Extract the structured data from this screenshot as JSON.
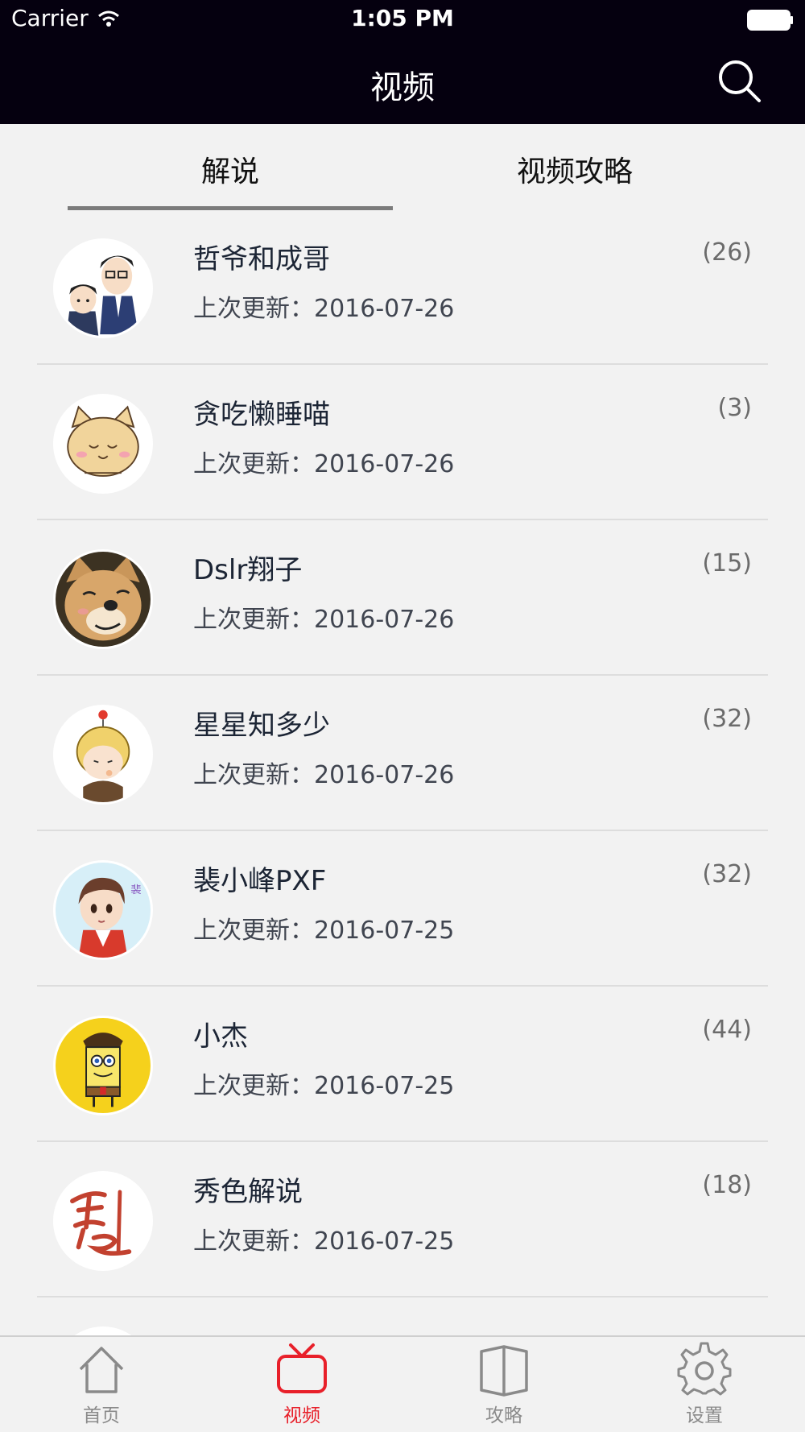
{
  "status_bar": {
    "carrier": "Carrier",
    "time": "1:05 PM"
  },
  "nav": {
    "title": "视频"
  },
  "tabs": [
    {
      "label": "解说",
      "selected": true
    },
    {
      "label": "视频攻略",
      "selected": false
    }
  ],
  "list": [
    {
      "name": "哲爷和成哥",
      "updated": "上次更新：2016-07-26",
      "count": "(26)",
      "avatar": "cartoon-two-men"
    },
    {
      "name": "贪吃懒睡喵",
      "updated": "上次更新：2016-07-26",
      "count": "(3)",
      "avatar": "cartoon-sleepy-cat"
    },
    {
      "name": "Dslr翔子",
      "updated": "上次更新：2016-07-26",
      "count": "(15)",
      "avatar": "shiba-dog"
    },
    {
      "name": "星星知多少",
      "updated": "上次更新：2016-07-26",
      "count": "(32)",
      "avatar": "cartoon-blonde-kid"
    },
    {
      "name": "裴小峰PXF",
      "updated": "上次更新：2016-07-25",
      "count": "(32)",
      "avatar": "cartoon-boy"
    },
    {
      "name": "小杰",
      "updated": "上次更新：2016-07-25",
      "count": "(44)",
      "avatar": "sponge-character"
    },
    {
      "name": "秀色解说",
      "updated": "上次更新：2016-07-25",
      "count": "(18)",
      "avatar": "calligraphy-logo"
    }
  ],
  "tabbar": [
    {
      "label": "首页",
      "icon": "home-icon",
      "active": false
    },
    {
      "label": "视频",
      "icon": "tv-icon",
      "active": true
    },
    {
      "label": "攻略",
      "icon": "book-icon",
      "active": false
    },
    {
      "label": "设置",
      "icon": "gear-icon",
      "active": false
    }
  ],
  "colors": {
    "nav_bg": "#05000f",
    "accent": "#e8202a",
    "tab_underline": "#7b7b7b",
    "background": "#f2f2f2"
  }
}
